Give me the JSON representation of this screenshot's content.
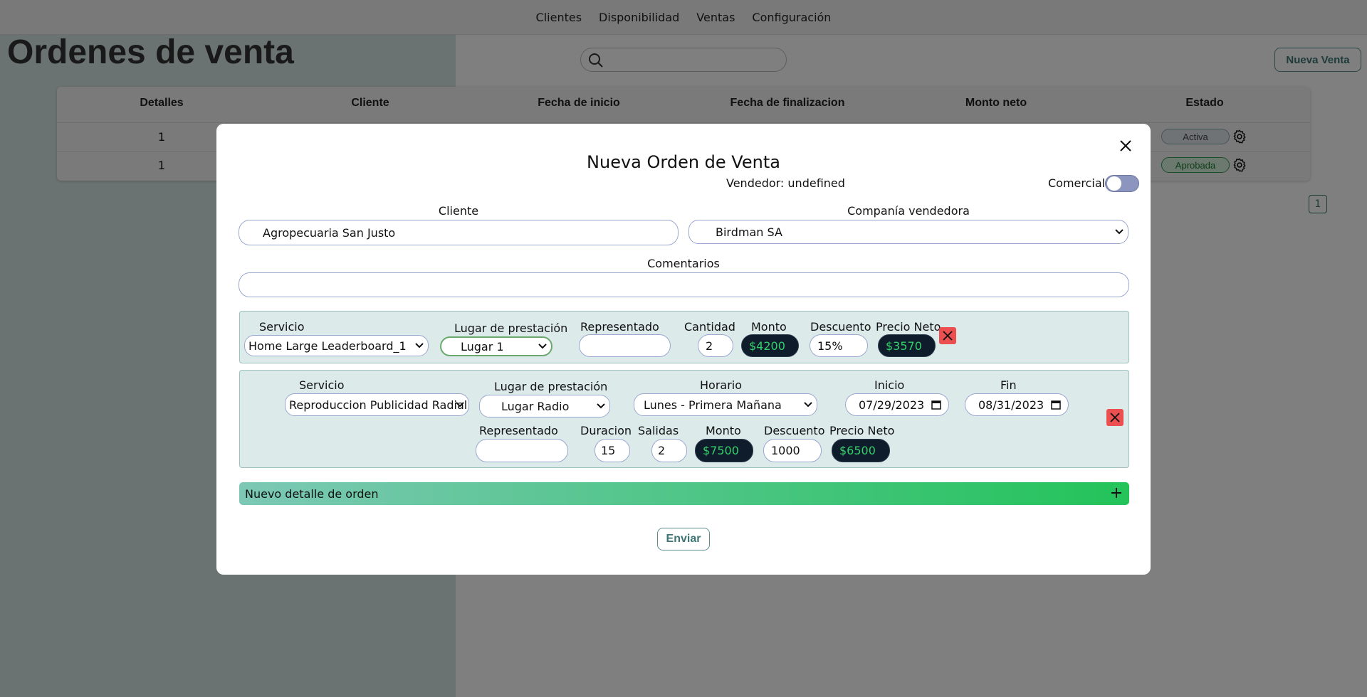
{
  "nav": {
    "items": [
      "Clientes",
      "Disponibilidad",
      "Ventas",
      "Configuración"
    ]
  },
  "page": {
    "title": "Ordenes de venta",
    "new_button": "Nueva Venta"
  },
  "table": {
    "headers": [
      "Detalles",
      "Cliente",
      "Fecha de inicio",
      "Fecha de finalizacion",
      "Monto neto",
      "Estado"
    ],
    "rows": [
      {
        "detalles": "1",
        "estado": "Activa"
      },
      {
        "detalles": "1",
        "estado": "Aprobada"
      }
    ]
  },
  "pagination": {
    "current_page": "1"
  },
  "modal": {
    "title": "Nueva Orden de Venta",
    "vendedor": "Vendedor: undefined",
    "comercial_label": "Comercial",
    "comercial_on": false,
    "cliente_label": "Cliente",
    "cliente_value": "Agropecuaria San Justo",
    "compania_label": "Companía vendedora",
    "compania_value": "Birdman SA",
    "comentarios_label": "Comentarios",
    "comentarios_value": "",
    "detail1": {
      "servicio_label": "Servicio",
      "servicio_value": "Home Large Leaderboard_1",
      "lugar_label": "Lugar de prestación",
      "lugar_value": "Lugar 1",
      "representado_label": "Representado",
      "representado_value": "",
      "cantidad_label": "Cantidad",
      "cantidad_value": "2",
      "monto_label": "Monto",
      "monto_value": "$4200",
      "descuento_label": "Descuento",
      "descuento_value": "15%",
      "precio_label": "Precio Neto",
      "precio_value": "$3570"
    },
    "detail2": {
      "servicio_label": "Servicio",
      "servicio_value": "Reproduccion Publicidad Radial",
      "lugar_label": "Lugar de prestación",
      "lugar_value": "Lugar Radio",
      "horario_label": "Horario",
      "horario_value": "Lunes - Primera Mañana",
      "inicio_label": "Inicio",
      "inicio_value": "07/29/2023",
      "fin_label": "Fin",
      "fin_value": "08/31/2023",
      "representado_label": "Representado",
      "representado_value": "",
      "duracion_label": "Duracion",
      "duracion_value": "15",
      "salidas_label": "Salidas",
      "salidas_value": "2",
      "monto_label": "Monto",
      "monto_value": "$7500",
      "descuento_label": "Descuento",
      "descuento_value": "1000",
      "precio_label": "Precio Neto",
      "precio_value": "$6500"
    },
    "new_detail_label": "Nuevo detalle de orden",
    "send_button": "Enviar"
  },
  "colors": {
    "accent": "#3d7575",
    "dark_field": "#0f1c2b",
    "money_text": "#34d06a",
    "delete": "#ec4f4f",
    "badge_active": "#dfe6ea",
    "badge_approved": "#d7f2dc"
  },
  "icons": [
    "search-icon",
    "gear-icon",
    "close-icon",
    "chevron-down-icon",
    "calendar-icon",
    "delete-icon",
    "plus-icon"
  ]
}
